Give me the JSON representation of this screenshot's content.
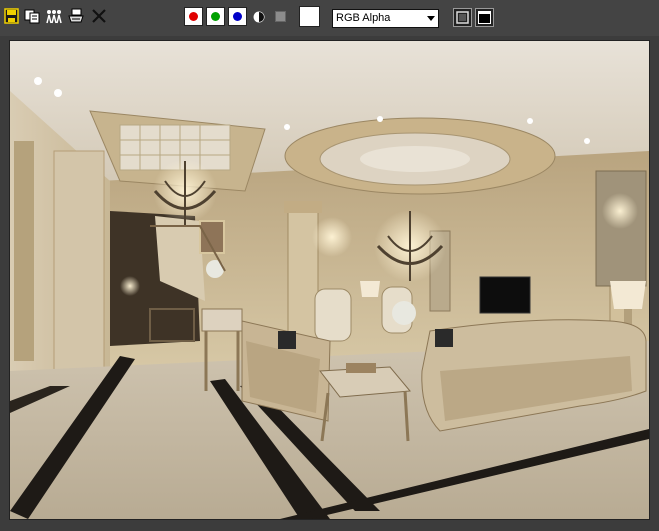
{
  "toolbar": {
    "icons": [
      "save-icon",
      "copy-icon",
      "clone-window-icon",
      "print-icon",
      "clear-icon"
    ],
    "channels": [
      {
        "name": "red-channel",
        "color": "#e00000"
      },
      {
        "name": "green-channel",
        "color": "#00a000"
      },
      {
        "name": "blue-channel",
        "color": "#0000c8"
      }
    ],
    "mono_icon": "monochrome-icon",
    "clear_swatch_icon": "clear-color-icon",
    "swatch_color": "#ffffff",
    "channel_select": {
      "value": "RGB Alpha"
    },
    "view_buttons": [
      "display-mode-icon",
      "display-toggle-icon"
    ]
  },
  "render": {
    "description_icon": "rendered-image-icon",
    "palette": {
      "wall": "#c9b793",
      "ceiling": "#ddd3c4",
      "floor": "#b7ab95",
      "dark_stripe": "#1e1a16",
      "sofa": "#cdbd9e"
    }
  }
}
